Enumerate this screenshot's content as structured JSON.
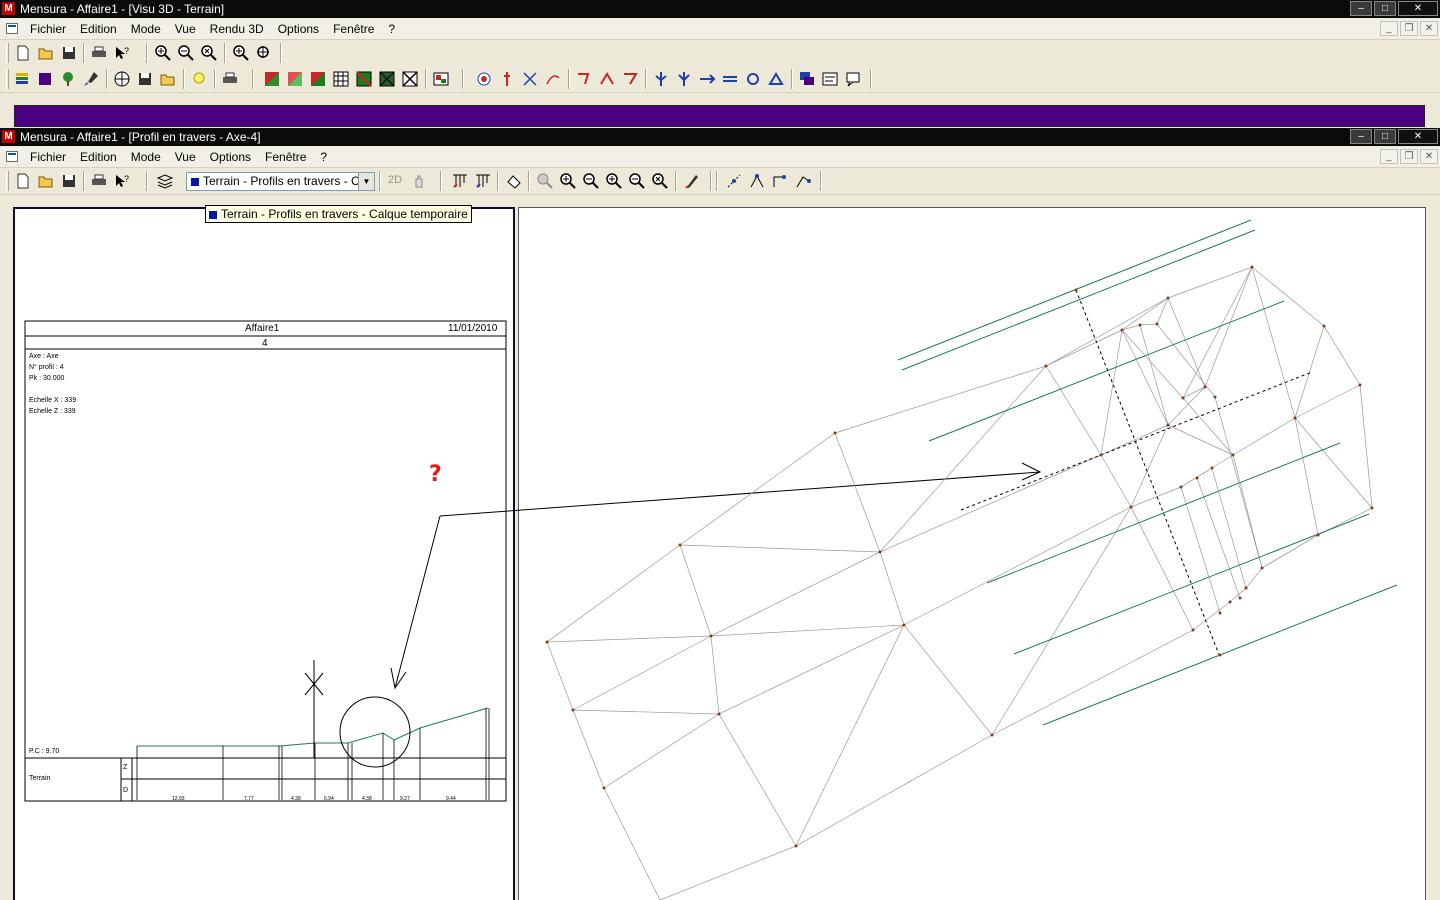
{
  "window1": {
    "title": "Mensura - Affaire1 - [Visu 3D - Terrain]",
    "menu": [
      "Fichier",
      "Edition",
      "Mode",
      "Vue",
      "Rendu 3D",
      "Options",
      "Fenêtre",
      "?"
    ]
  },
  "window2": {
    "title": "Mensura - Affaire1 - [Profil en travers  - Axe-4]",
    "menu": [
      "Fichier",
      "Edition",
      "Mode",
      "Vue",
      "Options",
      "Fenêtre",
      "?"
    ]
  },
  "layer_combo": {
    "value": "Terrain - Profils en travers - Calque temporaire"
  },
  "tooltip": {
    "text": "Terrain - Profils en travers - Calque temporaire"
  },
  "mode_2d_label": "2D",
  "icon_names": [
    "new-file-icon",
    "open-folder-icon",
    "save-icon",
    "print-icon",
    "help-pointer-icon",
    "zoom-in-icon",
    "zoom-out-icon",
    "zoom-extents-icon",
    "layers-icon",
    "pan-icon",
    "select-icon",
    "move-icon",
    "rotate-icon"
  ],
  "document": {
    "title": "Affaire1",
    "date": "11/01/2010",
    "profile_number": "4",
    "info_lines": [
      "Axe : Axe",
      "N° profil : 4",
      "Pk : 30.000",
      "",
      "Echelle X : 339",
      "Echelle Z : 339"
    ],
    "pc_label": "P.C : 9.70",
    "row_label": "Terrain",
    "z_label": "Z",
    "d_label": "D",
    "distances": [
      "12.93",
      "7.77",
      "4.38",
      "6.94",
      "4.38",
      "9.27",
      "9.44"
    ]
  },
  "annotation": {
    "question_mark": "?"
  },
  "colors": {
    "purple_bar": "#4b0082",
    "green_lines": "#1e7b5b",
    "mesh": "#9a9a9a",
    "points": "#8b3a1a",
    "question": "#e11b1b"
  }
}
